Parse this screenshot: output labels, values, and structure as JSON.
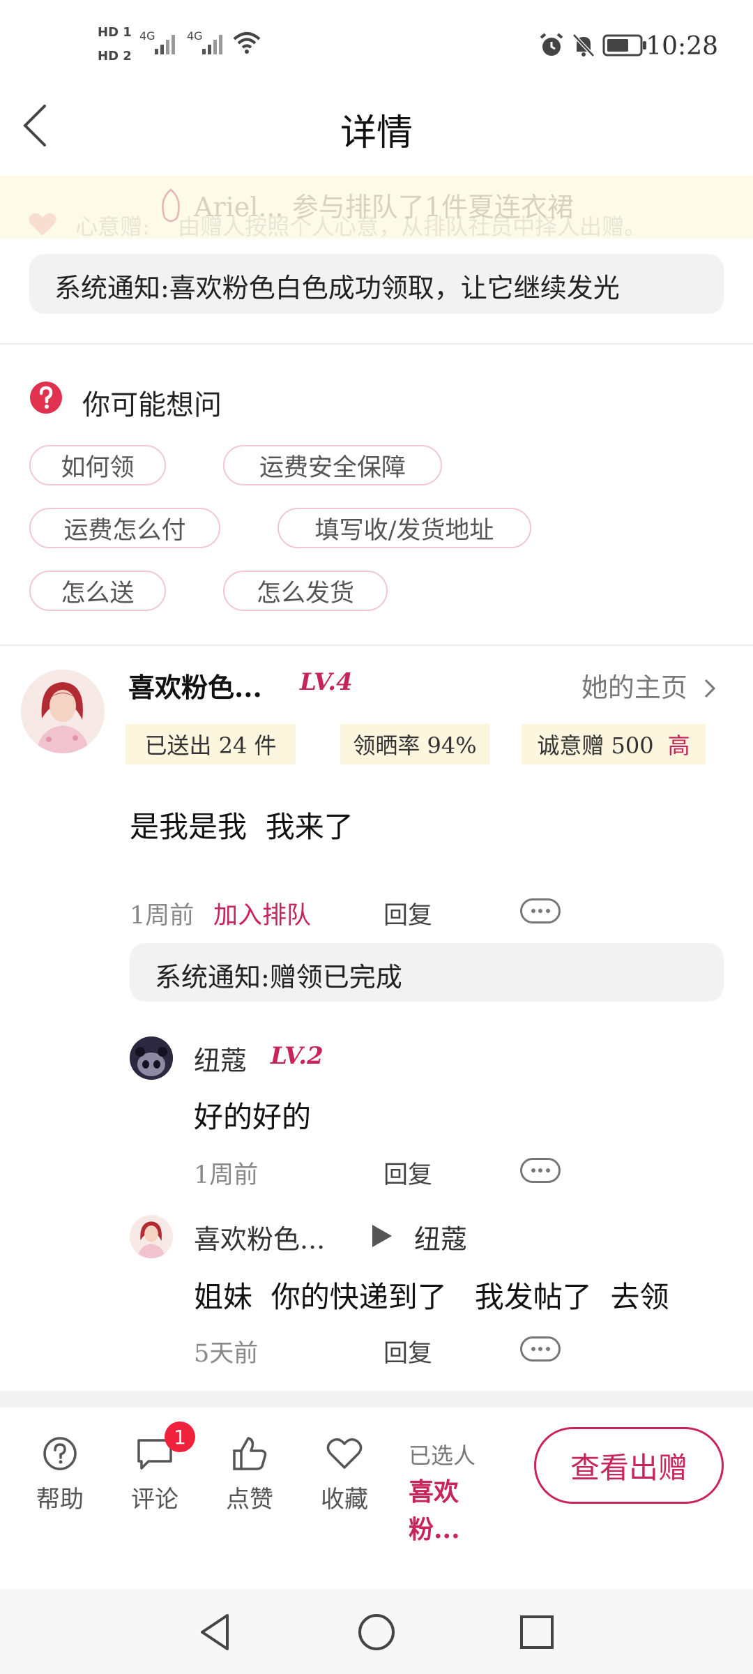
{
  "status_bar": {
    "hd1": "HD 1",
    "hd2": "HD 2",
    "net1": "4G",
    "net2": "4G",
    "time": "10:28"
  },
  "header": {
    "title": "详情",
    "back_icon": "chevron-left-icon"
  },
  "banner": {
    "front_text": "Ariel... 参与排队了1件夏连衣裙",
    "back_label": "心意赠:",
    "back_text": "由赠人按照个人心意，从排队社员中择人出赠。"
  },
  "system_notice": "系统通知:喜欢粉色白色成功领取，让它继续发光",
  "faq": {
    "title": "你可能想问",
    "chips": [
      "如何领",
      "运费安全保障",
      "运费怎么付",
      "填写收/发货地址",
      "怎么送",
      "怎么发货"
    ]
  },
  "post": {
    "author": "喜欢粉色...",
    "level": "LV.4",
    "homepage_link": "她的主页",
    "stats": {
      "sent": "已送出 24 件",
      "claim_rate": "领晒率 94%",
      "sincerity_label": "诚意赠 500",
      "sincerity_level": "高"
    },
    "text": "是我是我  我来了",
    "time": "1周前",
    "action": "加入排队",
    "reply_label": "回复",
    "system_box": "系统通知:赠领已完成"
  },
  "replies": [
    {
      "author": "纽蔻",
      "level": "LV.2",
      "text": "好的好的",
      "time": "1周前",
      "reply_label": "回复"
    },
    {
      "author": "喜欢粉色...",
      "reply_to": "纽蔻",
      "text": "姐妹  你的快递到了   我发帖了  去领",
      "time": "5天前",
      "reply_label": "回复"
    }
  ],
  "bottom_bar": {
    "tabs": [
      {
        "label": "帮助",
        "icon": "help-icon"
      },
      {
        "label": "评论",
        "icon": "comment-icon",
        "badge": "1"
      },
      {
        "label": "点赞",
        "icon": "thumbs-up-icon"
      },
      {
        "label": "收藏",
        "icon": "heart-icon"
      }
    ],
    "selected_label": "已选人",
    "selected_name": "喜欢粉...",
    "cta": "查看出赠"
  },
  "colors": {
    "accent": "#c8245c",
    "badge": "#f0213b",
    "stat_bg": "#fdf6df"
  }
}
